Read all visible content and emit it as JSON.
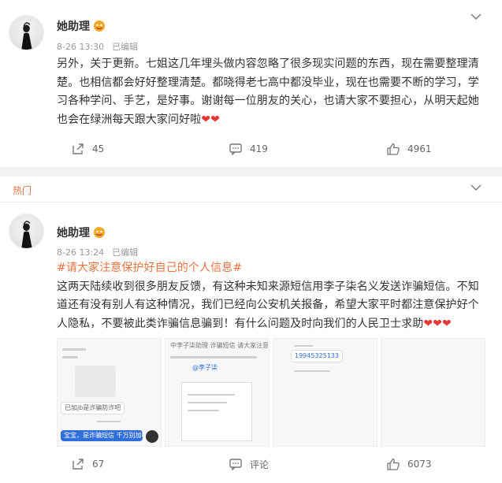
{
  "post1": {
    "author": "她助理",
    "time": "8-26 13:30",
    "edited": "已编辑",
    "text": "另外，关于更新。七姐这几年埋头做内容忽略了很多现实问题的东西，现在需要整理清楚。也相信都会好好整理清楚。都晓得老七高中都没毕业，现在也需要不断的学习，学习各种学问、手艺，是好事。谢谢每一位朋友的关心，也请大家不要担心，从明天起她也会在绿洲每天跟大家问好啦",
    "hearts": "❤❤",
    "repost_count": "45",
    "comment_count": "419",
    "like_count": "4961"
  },
  "section_label": "热门",
  "post2": {
    "author": "她助理",
    "time": "8-26 13:24",
    "edited": "已编辑",
    "hashtag": "#请大家注意保护好自己的个人信息#",
    "text": "这两天陆续收到很多朋友反馈，有这种未知来源短信用李子柒名义发送诈骗短信。不知道还有没有别人有这种情况，我们已经向公安机关报备，希望大家平时都注意保护好个人隐私，不要被此类诈骗信息骗到！有什么问题及时向我们的人民卫士求助",
    "hearts": "❤❤❤",
    "repost_count": "67",
    "comment_count": "评论",
    "like_count": "6073",
    "images": [
      {
        "bubble1": "已加jb是诈骗防诈吧",
        "bubble2": "宝宝，是诈骗短信 千万别加啊 ~"
      },
      {
        "header": "中李子柒助理 诈骗短信 请大家注意防骗",
        "tag": "@李子柒"
      },
      {
        "phone": "19945325133"
      },
      {}
    ]
  }
}
